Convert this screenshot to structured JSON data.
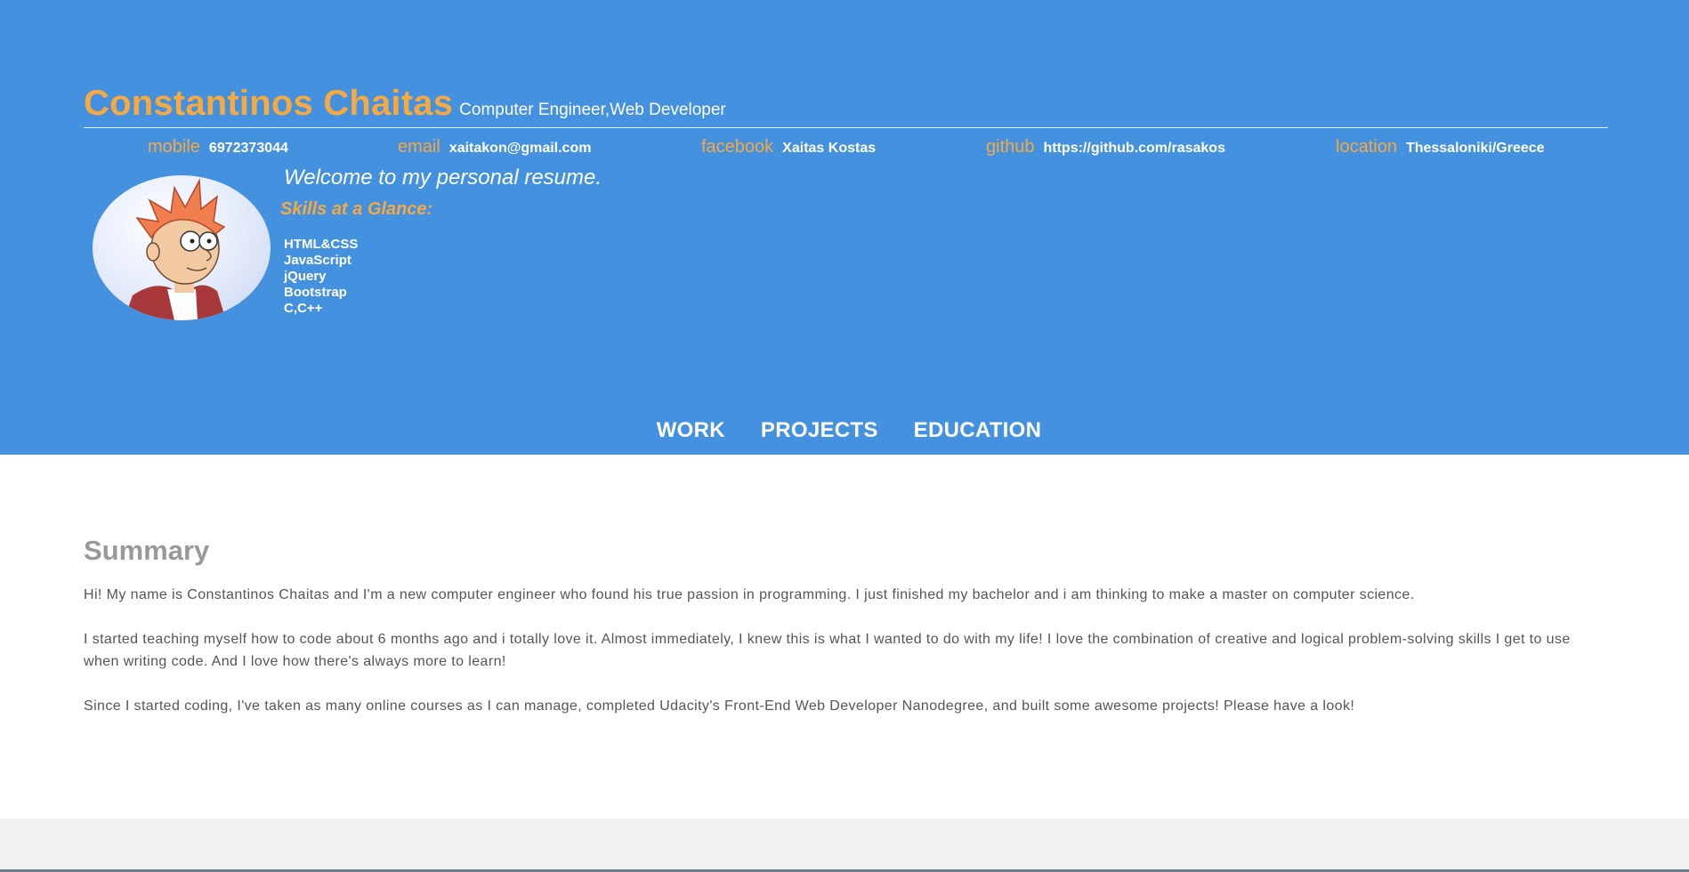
{
  "header": {
    "name": "Constantinos Chaitas",
    "role": "Computer Engineer,Web Developer",
    "contacts": [
      {
        "label": "mobile",
        "value": "6972373044"
      },
      {
        "label": "email",
        "value": "xaitakon@gmail.com"
      },
      {
        "label": "facebook",
        "value": "Xaitas Kostas"
      },
      {
        "label": "github",
        "value": "https://github.com/rasakos"
      },
      {
        "label": "location",
        "value": "Thessaloniki/Greece"
      }
    ],
    "welcome": "Welcome to my personal resume.",
    "skills_title": "Skills at a Glance:",
    "skills": [
      "HTML&CSS",
      "JavaScript",
      "jQuery",
      "Bootstrap",
      "C,C++"
    ],
    "avatar_icon": "cartoon-character-avatar"
  },
  "nav": {
    "items": [
      "WORK",
      "PROJECTS",
      "EDUCATION"
    ]
  },
  "summary": {
    "title": "Summary",
    "paragraphs": [
      "Hi! My name is Constantinos Chaitas and I'm a new computer engineer who found his true passion in programming. I just finished my bachelor and i am thinking to make a master on computer science.",
      "I started teaching myself how to code about 6 months ago and i totally love it. Almost immediately, I knew this is what I wanted to do with my life! I love the combination of creative and logical problem-solving skills I get to use when writing code. And I love how there's always more to learn!",
      "Since I started coding, I've taken as many online courses as I can manage, completed Udacity's Front-End Web Developer Nanodegree, and built some awesome projects! Please have a look!"
    ]
  },
  "colors": {
    "header_bg": "#4491e0",
    "accent": "#f5a940",
    "text_white": "#ffffff",
    "body_text": "#555555",
    "summary_title": "#999999",
    "page_bg": "#f2f2f2"
  }
}
